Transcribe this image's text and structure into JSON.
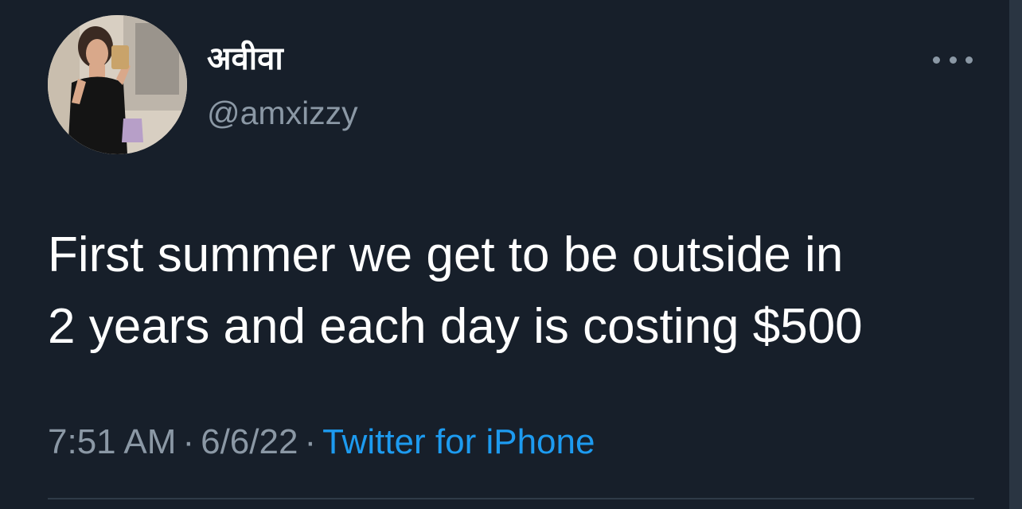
{
  "tweet": {
    "display_name": "अवीवा",
    "handle": "@amxizzy",
    "text_lines": [
      "First summer we get to be outside in",
      "2 years and each day is costing $500"
    ],
    "time": "7:51 AM",
    "date": "6/6/22",
    "separator": "·",
    "source": "Twitter for iPhone"
  },
  "icons": {
    "more": "more-horizontal-icon"
  },
  "colors": {
    "background": "#171f2a",
    "primary_text": "#ffffff",
    "secondary_text": "#8b98a5",
    "link": "#1d9bf0"
  }
}
